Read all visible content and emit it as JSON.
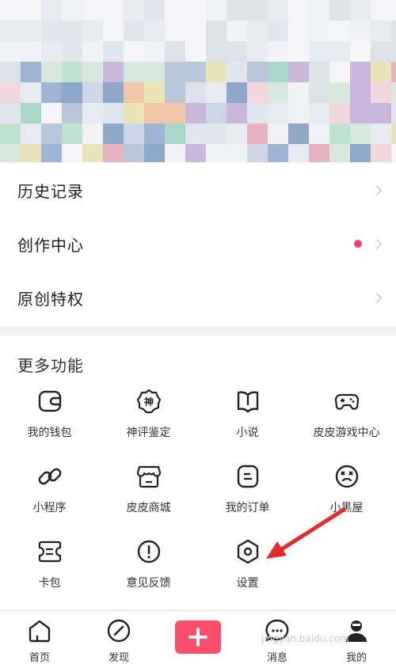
{
  "menu": {
    "history": "历史记录",
    "creator_center": "创作中心",
    "original_privilege": "原创特权"
  },
  "more": {
    "title": "更多功能",
    "items": [
      {
        "label": "我的钱包",
        "icon": "wallet-icon"
      },
      {
        "label": "神评鉴定",
        "icon": "shen-badge-icon"
      },
      {
        "label": "小说",
        "icon": "book-icon"
      },
      {
        "label": "皮皮游戏中心",
        "icon": "gamepad-icon"
      },
      {
        "label": "小程序",
        "icon": "link-icon"
      },
      {
        "label": "皮皮商城",
        "icon": "store-icon"
      },
      {
        "label": "我的订单",
        "icon": "order-icon"
      },
      {
        "label": "小黑屋",
        "icon": "dizzy-face-icon"
      },
      {
        "label": "卡包",
        "icon": "ticket-icon"
      },
      {
        "label": "意见反馈",
        "icon": "exclamation-icon"
      },
      {
        "label": "设置",
        "icon": "hexagon-settings-icon"
      }
    ]
  },
  "tabbar": {
    "home": "首页",
    "discover": "发现",
    "messages": "消息",
    "me": "我的"
  },
  "colors": {
    "accent": "#ff4d6d",
    "dot": "#ff3d67",
    "annotation_arrow": "#e8292b"
  },
  "watermark": "jingyan.baidu.com"
}
